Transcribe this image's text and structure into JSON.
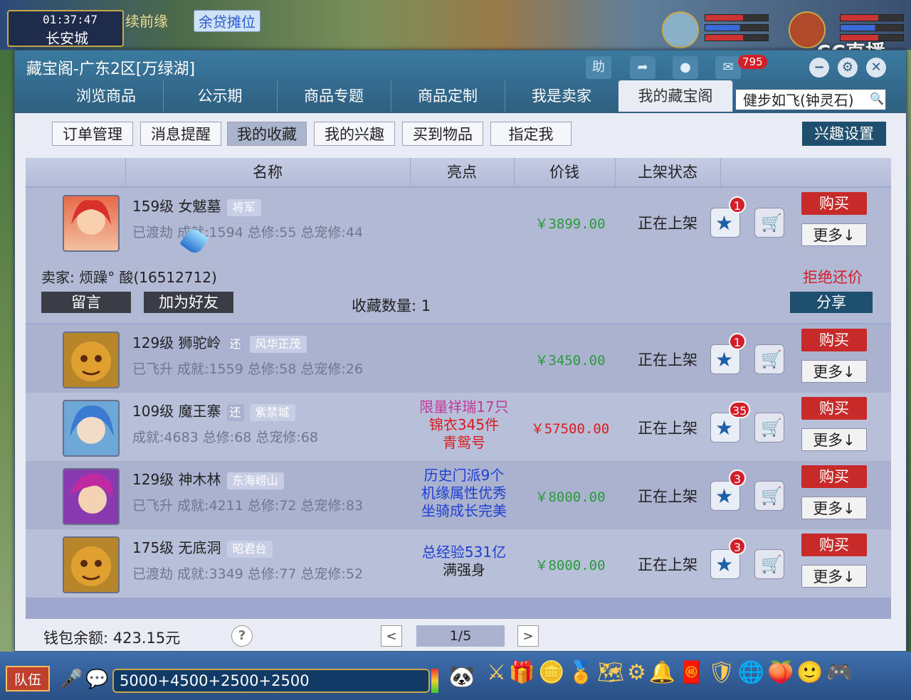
{
  "game": {
    "clock": "01:37:47",
    "city": "长安城",
    "links": [
      "续前缘",
      "余贷摊位"
    ],
    "overlay_logo": "CC直播",
    "chat_input": "5000+4500+2500+2500",
    "team_label": "队伍"
  },
  "window": {
    "title": "藏宝阁-广东2区[万绿湖]",
    "help_label": "助",
    "message_count": "795"
  },
  "nav": {
    "tabs": [
      "浏览商品",
      "公示期",
      "商品专题",
      "商品定制",
      "我是卖家",
      "我的藏宝阁"
    ],
    "active": "我的藏宝阁",
    "account": "健步如飞(钟灵石)"
  },
  "subtabs": {
    "items": [
      "订单管理",
      "消息提醒",
      "我的收藏",
      "我的兴趣",
      "买到物品",
      "指定我"
    ],
    "active": "我的收藏",
    "interest_settings": "兴趣设置"
  },
  "table": {
    "headers": [
      "名称",
      "亮点",
      "价钱",
      "上架状态"
    ],
    "rows": [
      {
        "name": "159级 女魃墓",
        "tags": [
          "将军"
        ],
        "stats": "已渡劫 成就:1594 总修:55 总宠修:44",
        "highlight": [],
        "price": "￥3899.00",
        "price_color": "#2a9a3a",
        "status": "正在上架",
        "fav_count": "1",
        "buy": "购买",
        "more": "更多↓",
        "seller": "卖家: 烦躁° 酸(16512712)",
        "reject": "拒绝还价",
        "message_btn": "留言",
        "friend_btn": "加为好友",
        "fav_total": "收藏数量: 1",
        "share": "分享"
      },
      {
        "name": "129级 狮驼岭",
        "tags": [
          "还",
          "风华正茂"
        ],
        "stats": "已飞升 成就:1559 总修:58 总宠修:26",
        "highlight": [],
        "price": "￥3450.00",
        "price_color": "#2a9a3a",
        "status": "正在上架",
        "fav_count": "1",
        "buy": "购买",
        "more": "更多↓"
      },
      {
        "name": "109级 魔王寨",
        "tags": [
          "还",
          "紫禁城"
        ],
        "stats": "成就:4683 总修:68 总宠修:68",
        "highlight": [
          "限量祥瑞17只",
          "锦衣345件",
          "青鸳号"
        ],
        "highlight_colors": [
          "#c0399a",
          "#d81c1c",
          "#d81c1c"
        ],
        "price": "￥57500.00",
        "price_color": "#d81c1c",
        "status": "正在上架",
        "fav_count": "35",
        "buy": "购买",
        "more": "更多↓"
      },
      {
        "name": "129级 神木林",
        "tags": [
          "东海崂山"
        ],
        "stats": "已飞升 成就:4211 总修:72 总宠修:83",
        "highlight": [
          "历史门派9个",
          "机缘属性优秀",
          "坐骑成长完美"
        ],
        "highlight_colors": [
          "#1f3fd0",
          "#1f3fd0",
          "#1f3fd0"
        ],
        "price": "￥8000.00",
        "price_color": "#2a9a3a",
        "status": "正在上架",
        "fav_count": "3",
        "buy": "购买",
        "more": "更多↓"
      },
      {
        "name": "175级 无底洞",
        "tags": [
          "昭君台"
        ],
        "stats": "已渡劫 成就:3349 总修:77 总宠修:52",
        "highlight": [
          "总经验531亿",
          "满强身"
        ],
        "highlight_colors": [
          "#1f3fd0",
          "#222222"
        ],
        "price": "￥8000.00",
        "price_color": "#2a9a3a",
        "status": "正在上架",
        "fav_count": "3",
        "buy": "购买",
        "more": "更多↓"
      }
    ]
  },
  "footer": {
    "balance": "钱包余额: 423.15元",
    "help": "?",
    "prev": "<",
    "page": "1/5",
    "next": ">"
  }
}
